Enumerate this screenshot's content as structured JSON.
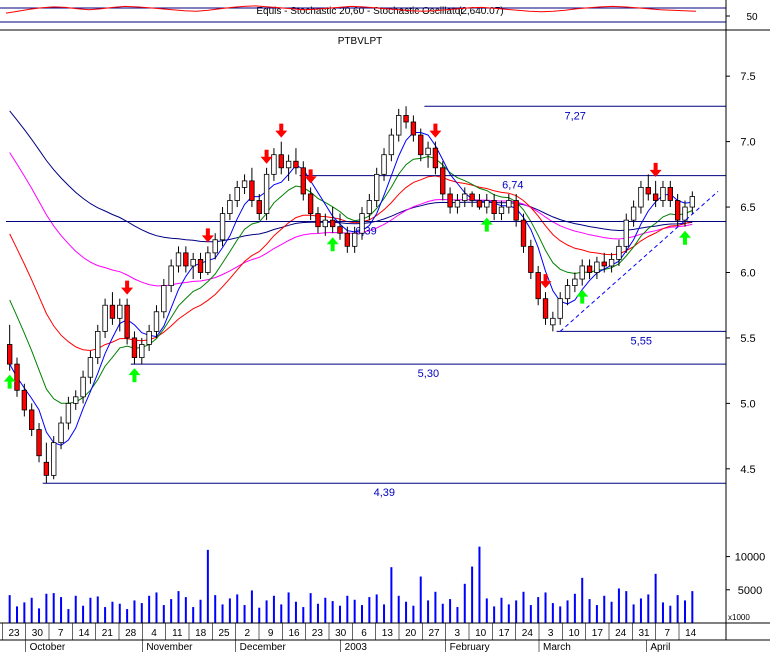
{
  "colors": {
    "up_candle": "#ffffff",
    "down_candle": "#ff0000",
    "candle_outline": "#000000",
    "ma_short": "#0000ff",
    "ma_mid": "#008000",
    "ma_long": "#ff0000",
    "ma_longest": "#ff00ff",
    "ma_dark": "#000080",
    "level_line": "#000080",
    "level_label": "#0000c0",
    "volume": "#0000ff",
    "sell_arrow": "#ff0000",
    "buy_arrow": "#00ff00",
    "grid": "#000000"
  },
  "chart_data": [
    {
      "type": "line",
      "panel": "indicator",
      "title": "Equis - Stochastic 20,60 - Stochastic Oscillator",
      "overlay_text": "(2,640.07)",
      "y_ticks": [
        50
      ],
      "y_tick_labels": [
        "50"
      ],
      "ylim": [
        0,
        100
      ],
      "series": [
        {
          "values": [
            62,
            70,
            78,
            84,
            88,
            86,
            80,
            76,
            80,
            86,
            90,
            88,
            84,
            80,
            76,
            72,
            70,
            74,
            80,
            86,
            90,
            92,
            88,
            84,
            80,
            76,
            78,
            82,
            86,
            90,
            88,
            84,
            80,
            76,
            72,
            70,
            72,
            76,
            80,
            84,
            86,
            82,
            78,
            74,
            70,
            68,
            70,
            74,
            80,
            84,
            88,
            90,
            88,
            84,
            80,
            76,
            74,
            72,
            70
          ]
        }
      ]
    },
    {
      "type": "candlestick",
      "panel": "price",
      "title": "PTBVLPT",
      "ylim": [
        4.3,
        7.7
      ],
      "y_ticks": [
        4.5,
        5.0,
        5.5,
        6.0,
        6.5,
        7.0,
        7.5
      ],
      "y_tick_labels": [
        "4.5",
        "5.0",
        "5.5",
        "6.0",
        "6.5",
        "7.0",
        "7.5"
      ],
      "candles": [
        [
          5.45,
          5.6,
          5.25,
          5.3
        ],
        [
          5.3,
          5.35,
          5.05,
          5.1
        ],
        [
          5.1,
          5.15,
          4.9,
          4.95
        ],
        [
          4.95,
          5.0,
          4.75,
          4.8
        ],
        [
          4.8,
          4.85,
          4.55,
          4.6
        ],
        [
          4.55,
          4.7,
          4.39,
          4.45
        ],
        [
          4.45,
          4.75,
          4.42,
          4.7
        ],
        [
          4.7,
          4.9,
          4.65,
          4.85
        ],
        [
          4.85,
          5.05,
          4.8,
          5.0
        ],
        [
          5.0,
          5.1,
          4.95,
          5.05
        ],
        [
          5.05,
          5.25,
          5.0,
          5.2
        ],
        [
          5.2,
          5.4,
          5.15,
          5.35
        ],
        [
          5.35,
          5.6,
          5.3,
          5.55
        ],
        [
          5.55,
          5.8,
          5.5,
          5.75
        ],
        [
          5.75,
          5.85,
          5.6,
          5.65
        ],
        [
          5.65,
          5.8,
          5.55,
          5.75
        ],
        [
          5.75,
          5.8,
          5.45,
          5.5
        ],
        [
          5.5,
          5.55,
          5.3,
          5.35
        ],
        [
          5.35,
          5.5,
          5.3,
          5.45
        ],
        [
          5.45,
          5.6,
          5.4,
          5.55
        ],
        [
          5.55,
          5.75,
          5.5,
          5.7
        ],
        [
          5.7,
          5.95,
          5.65,
          5.9
        ],
        [
          5.9,
          6.1,
          5.85,
          6.05
        ],
        [
          6.05,
          6.2,
          6.0,
          6.15
        ],
        [
          6.15,
          6.2,
          6.0,
          6.05
        ],
        [
          6.05,
          6.15,
          5.95,
          6.1
        ],
        [
          6.1,
          6.15,
          5.95,
          6.0
        ],
        [
          6.0,
          6.2,
          5.98,
          6.15
        ],
        [
          6.15,
          6.3,
          6.1,
          6.25
        ],
        [
          6.25,
          6.5,
          6.2,
          6.45
        ],
        [
          6.45,
          6.6,
          6.4,
          6.55
        ],
        [
          6.55,
          6.7,
          6.5,
          6.65
        ],
        [
          6.65,
          6.75,
          6.6,
          6.7
        ],
        [
          6.7,
          6.8,
          6.5,
          6.55
        ],
        [
          6.55,
          6.6,
          6.4,
          6.45
        ],
        [
          6.45,
          6.8,
          6.4,
          6.75
        ],
        [
          6.75,
          6.95,
          6.7,
          6.9
        ],
        [
          6.9,
          7.0,
          6.75,
          6.8
        ],
        [
          6.8,
          6.9,
          6.7,
          6.85
        ],
        [
          6.85,
          6.95,
          6.75,
          6.8
        ],
        [
          6.8,
          6.85,
          6.55,
          6.6
        ],
        [
          6.6,
          6.65,
          6.4,
          6.45
        ],
        [
          6.45,
          6.5,
          6.3,
          6.35
        ],
        [
          6.35,
          6.45,
          6.28,
          6.4
        ],
        [
          6.4,
          6.5,
          6.3,
          6.35
        ],
        [
          6.35,
          6.45,
          6.25,
          6.3
        ],
        [
          6.3,
          6.35,
          6.15,
          6.2
        ],
        [
          6.2,
          6.35,
          6.15,
          6.3
        ],
        [
          6.3,
          6.5,
          6.25,
          6.45
        ],
        [
          6.45,
          6.6,
          6.4,
          6.55
        ],
        [
          6.55,
          6.8,
          6.5,
          6.75
        ],
        [
          6.75,
          6.95,
          6.7,
          6.9
        ],
        [
          6.9,
          7.1,
          6.85,
          7.05
        ],
        [
          7.05,
          7.25,
          7.0,
          7.2
        ],
        [
          7.2,
          7.27,
          7.1,
          7.15
        ],
        [
          7.15,
          7.2,
          7.0,
          7.05
        ],
        [
          7.05,
          7.1,
          6.85,
          6.9
        ],
        [
          6.9,
          7.0,
          6.8,
          6.95
        ],
        [
          6.95,
          7.0,
          6.75,
          6.8
        ],
        [
          6.8,
          6.85,
          6.55,
          6.6
        ],
        [
          6.6,
          6.65,
          6.45,
          6.5
        ],
        [
          6.5,
          6.6,
          6.45,
          6.55
        ],
        [
          6.55,
          6.65,
          6.5,
          6.6
        ],
        [
          6.6,
          6.62,
          6.5,
          6.55
        ],
        [
          6.55,
          6.6,
          6.48,
          6.5
        ],
        [
          6.5,
          6.6,
          6.45,
          6.55
        ],
        [
          6.55,
          6.6,
          6.4,
          6.45
        ],
        [
          6.45,
          6.55,
          6.4,
          6.5
        ],
        [
          6.5,
          6.6,
          6.45,
          6.55
        ],
        [
          6.55,
          6.6,
          6.35,
          6.4
        ],
        [
          6.4,
          6.45,
          6.15,
          6.2
        ],
        [
          6.2,
          6.25,
          5.95,
          6.0
        ],
        [
          6.0,
          6.05,
          5.75,
          5.8
        ],
        [
          5.8,
          5.85,
          5.6,
          5.65
        ],
        [
          5.6,
          5.7,
          5.55,
          5.65
        ],
        [
          5.65,
          5.85,
          5.6,
          5.8
        ],
        [
          5.8,
          5.95,
          5.75,
          5.9
        ],
        [
          5.9,
          6.0,
          5.85,
          5.95
        ],
        [
          5.95,
          6.1,
          5.9,
          6.05
        ],
        [
          6.05,
          6.1,
          5.95,
          6.0
        ],
        [
          6.0,
          6.12,
          5.95,
          6.08
        ],
        [
          6.08,
          6.15,
          6.0,
          6.05
        ],
        [
          6.05,
          6.15,
          6.0,
          6.1
        ],
        [
          6.1,
          6.25,
          6.05,
          6.2
        ],
        [
          6.2,
          6.45,
          6.15,
          6.4
        ],
        [
          6.4,
          6.55,
          6.35,
          6.5
        ],
        [
          6.5,
          6.7,
          6.45,
          6.65
        ],
        [
          6.65,
          6.75,
          6.55,
          6.6
        ],
        [
          6.6,
          6.7,
          6.5,
          6.55
        ],
        [
          6.55,
          6.7,
          6.5,
          6.65
        ],
        [
          6.65,
          6.7,
          6.5,
          6.55
        ],
        [
          6.55,
          6.6,
          6.35,
          6.4
        ],
        [
          6.4,
          6.55,
          6.35,
          6.5
        ],
        [
          6.5,
          6.62,
          6.45,
          6.58
        ]
      ],
      "levels": [
        {
          "value": 7.27,
          "label": "7,27",
          "start_index": 57
        },
        {
          "value": 6.74,
          "label": "6,74",
          "start_index": 40
        },
        {
          "value": 6.39,
          "label": "6,39",
          "start_index": 0
        },
        {
          "value": 5.55,
          "label": "5,55",
          "start_index": 75
        },
        {
          "value": 5.3,
          "label": "5,30",
          "start_index": 17
        },
        {
          "value": 4.39,
          "label": "4,39",
          "start_index": 5
        }
      ],
      "sell_arrows_at_index": [
        16,
        27,
        35,
        37,
        41,
        58,
        73,
        88
      ],
      "buy_arrows_at_index": [
        0,
        17,
        44,
        65,
        78,
        92
      ],
      "x_tick_labels": [
        "23",
        "30",
        "7",
        "14",
        "21",
        "28",
        "4",
        "11",
        "18",
        "25",
        "2",
        "9",
        "16",
        "23",
        "30",
        "6",
        "13",
        "20",
        "27",
        "3",
        "10",
        "17",
        "24",
        "3",
        "10",
        "17",
        "24",
        "31",
        "7",
        "14"
      ],
      "month_labels": [
        "October",
        "November",
        "December",
        "2003",
        "February",
        "March",
        "April"
      ]
    },
    {
      "type": "bar",
      "panel": "volume",
      "y_ticks": [
        5000,
        10000
      ],
      "y_tick_labels": [
        "5000",
        "10000"
      ],
      "unit_label": "x1000",
      "ylim": [
        0,
        14000
      ],
      "values": [
        4200,
        2500,
        3100,
        3800,
        2200,
        4400,
        4500,
        3900,
        2100,
        4100,
        2600,
        3800,
        4000,
        2400,
        3200,
        2900,
        2100,
        3400,
        3000,
        4100,
        4600,
        2700,
        3600,
        4800,
        3900,
        2400,
        3500,
        11000,
        4200,
        2800,
        3700,
        4300,
        2700,
        4900,
        2300,
        3400,
        4100,
        2800,
        4600,
        3200,
        2400,
        4500,
        2900,
        3800,
        3300,
        2600,
        4100,
        3500,
        2700,
        3900,
        4300,
        2800,
        8400,
        4100,
        3200,
        2600,
        7000,
        3400,
        4700,
        2900,
        3600,
        2400,
        5900,
        8500,
        11500,
        3700,
        2500,
        3800,
        2800,
        3400,
        4700,
        2700,
        3900,
        4600,
        3000,
        2500,
        3400,
        4400,
        6800,
        3600,
        2700,
        4100,
        3200,
        5200,
        4800,
        2800,
        3700,
        4300,
        7400,
        3100,
        2600,
        4200,
        3400,
        4800
      ]
    }
  ]
}
